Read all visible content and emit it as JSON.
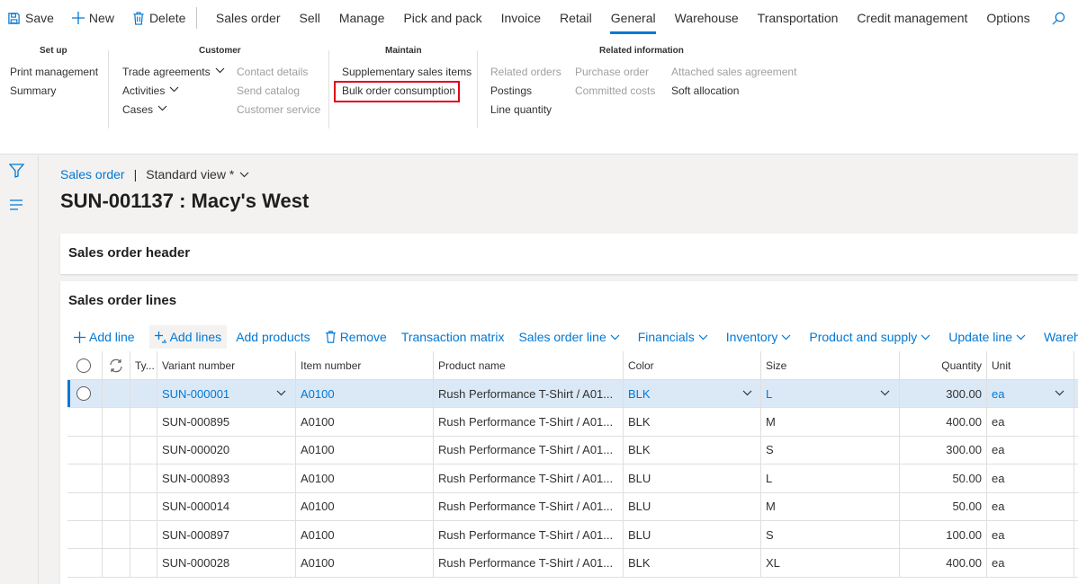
{
  "toolbar": {
    "save": "Save",
    "new": "New",
    "delete": "Delete",
    "tabs": [
      "Sales order",
      "Sell",
      "Manage",
      "Pick and pack",
      "Invoice",
      "Retail",
      "General",
      "Warehouse",
      "Transportation",
      "Credit management",
      "Options"
    ],
    "active_tab": "General"
  },
  "ribbon": {
    "setup": {
      "title": "Set up",
      "items": [
        "Print management",
        "Summary"
      ]
    },
    "customer": {
      "title": "Customer",
      "col1": [
        "Trade agreements",
        "Activities",
        "Cases"
      ],
      "col2": [
        "Contact details",
        "Send catalog",
        "Customer service"
      ]
    },
    "maintain": {
      "title": "Maintain",
      "items": [
        "Supplementary sales items",
        "Bulk order consumption"
      ]
    },
    "related": {
      "title": "Related information",
      "col1": [
        "Related orders",
        "Postings",
        "Line quantity"
      ],
      "col2": [
        "Purchase order",
        "Committed costs"
      ],
      "col3": [
        "Attached sales agreement",
        "Soft allocation"
      ]
    }
  },
  "breadcrumb": {
    "link": "Sales order",
    "separator": "|",
    "view": "Standard view *"
  },
  "page_title": "SUN-001137 : Macy's West",
  "panels": {
    "header": "Sales order header",
    "lines": "Sales order lines"
  },
  "lines_toolbar": {
    "add_line": "Add line",
    "add_lines": "Add lines",
    "add_products": "Add products",
    "remove": "Remove",
    "transaction_matrix": "Transaction matrix",
    "sales_order_line": "Sales order line",
    "financials": "Financials",
    "inventory": "Inventory",
    "product_and_supply": "Product and supply",
    "update_line": "Update line",
    "warehouse": "Warehouse"
  },
  "grid": {
    "columns": {
      "type": "Ty...",
      "variant": "Variant number",
      "item": "Item number",
      "product": "Product name",
      "color": "Color",
      "size": "Size",
      "quantity": "Quantity",
      "unit": "Unit"
    },
    "rows": [
      {
        "variant": "SUN-000001",
        "item": "A0100",
        "product": "Rush Performance T-Shirt / A01...",
        "color": "BLK",
        "size": "L",
        "quantity": "300.00",
        "unit": "ea"
      },
      {
        "variant": "SUN-000895",
        "item": "A0100",
        "product": "Rush Performance T-Shirt / A01...",
        "color": "BLK",
        "size": "M",
        "quantity": "400.00",
        "unit": "ea"
      },
      {
        "variant": "SUN-000020",
        "item": "A0100",
        "product": "Rush Performance T-Shirt / A01...",
        "color": "BLK",
        "size": "S",
        "quantity": "300.00",
        "unit": "ea"
      },
      {
        "variant": "SUN-000893",
        "item": "A0100",
        "product": "Rush Performance T-Shirt / A01...",
        "color": "BLU",
        "size": "L",
        "quantity": "50.00",
        "unit": "ea"
      },
      {
        "variant": "SUN-000014",
        "item": "A0100",
        "product": "Rush Performance T-Shirt / A01...",
        "color": "BLU",
        "size": "M",
        "quantity": "50.00",
        "unit": "ea"
      },
      {
        "variant": "SUN-000897",
        "item": "A0100",
        "product": "Rush Performance T-Shirt / A01...",
        "color": "BLU",
        "size": "S",
        "quantity": "100.00",
        "unit": "ea"
      },
      {
        "variant": "SUN-000028",
        "item": "A0100",
        "product": "Rush Performance T-Shirt / A01...",
        "color": "BLK",
        "size": "XL",
        "quantity": "400.00",
        "unit": "ea"
      }
    ]
  },
  "colors": {
    "accent": "#0078d4",
    "highlight": "#e3001b",
    "selected_row": "#dbe9f7"
  },
  "icons": [
    "save-icon",
    "plus-icon",
    "trash-icon",
    "search-icon",
    "filter-icon",
    "menu-icon",
    "refresh-icon",
    "chevron-down-icon"
  ]
}
